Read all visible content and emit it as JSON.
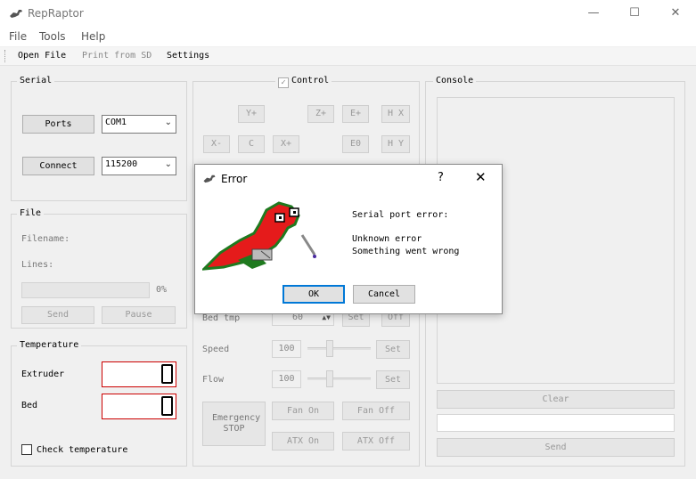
{
  "window": {
    "title": "RepRaptor",
    "minimize": "—",
    "maximize": "☐",
    "close": "✕"
  },
  "menu": [
    "File",
    "Tools",
    "Help"
  ],
  "toolbar": {
    "open_file": "Open File",
    "print_sd": "Print from SD",
    "settings": "Settings"
  },
  "serial": {
    "title": "Serial",
    "ports_label": "Ports",
    "port_value": "COM1",
    "connect_label": "Connect",
    "baud_value": "115200"
  },
  "file": {
    "title": "File",
    "filename_label": "Filename:",
    "lines_label": "Lines:",
    "progress_percent": "0%",
    "progress_value": 0,
    "send_label": "Send",
    "pause_label": "Pause"
  },
  "temperature": {
    "title": "Temperature",
    "extruder_label": "Extruder",
    "bed_label": "Bed",
    "check_label": "Check temperature"
  },
  "control": {
    "title": "Control",
    "y_plus": "Y+",
    "z_plus": "Z+",
    "e_plus": "E+",
    "home_x": "H X",
    "x_minus": "X-",
    "center": "C",
    "x_plus": "X+",
    "e_zero": "E0",
    "home_y": "H Y",
    "bed_tmp_label": "Bed tmp",
    "bed_tmp_value": "60",
    "set_label": "Set",
    "off_label": "Off",
    "speed_label": "Speed",
    "speed_value": "100",
    "flow_label": "Flow",
    "flow_value": "100",
    "emergency_label": "Emergency STOP",
    "fan_on": "Fan On",
    "fan_off": "Fan Off",
    "atx_on": "ATX On",
    "atx_off": "ATX Off"
  },
  "console": {
    "title": "Console",
    "clear_label": "Clear",
    "send_label": "Send"
  },
  "dialog": {
    "title": "Error",
    "help": "?",
    "close": "✕",
    "line1": "Serial port error:",
    "line2": "Unknown error",
    "line3": "Something went wrong",
    "ok_label": "OK",
    "cancel_label": "Cancel"
  }
}
